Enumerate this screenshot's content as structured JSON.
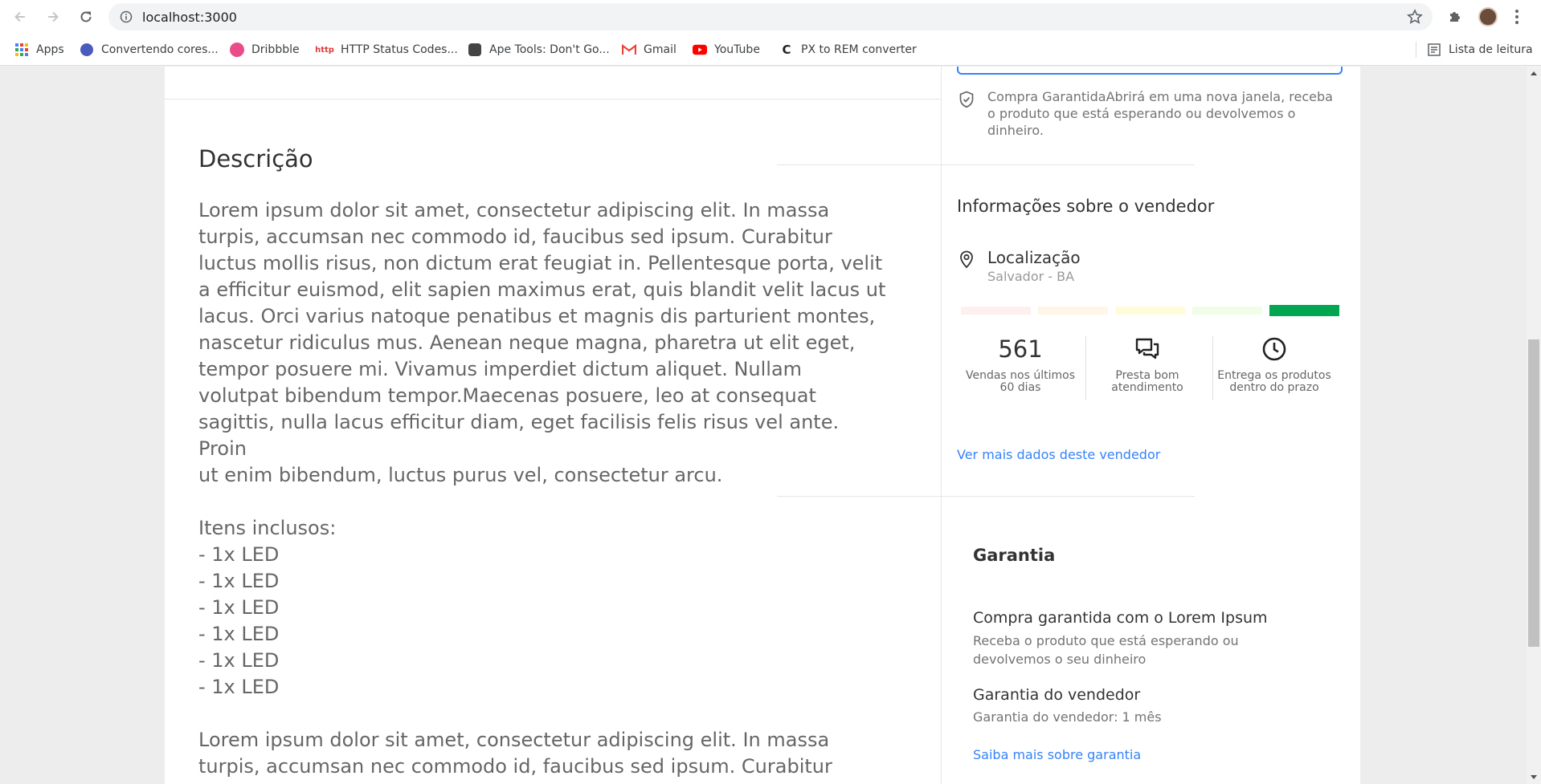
{
  "browser": {
    "url": "localhost:3000",
    "bookmarks": [
      {
        "label": "Apps",
        "icon": "apps-grid-icon"
      },
      {
        "label": "Convertendo cores...",
        "icon": "globe-icon"
      },
      {
        "label": "Dribbble",
        "icon": "dribbble-icon"
      },
      {
        "label": "HTTP Status Codes...",
        "icon": "http-icon"
      },
      {
        "label": "Ape Tools: Don't Go...",
        "icon": "ape-icon"
      },
      {
        "label": "Gmail",
        "icon": "gmail-icon"
      },
      {
        "label": "YouTube",
        "icon": "youtube-icon"
      },
      {
        "label": "PX to REM converter",
        "icon": "c-icon"
      }
    ],
    "reading_list": "Lista de leitura"
  },
  "description": {
    "title": "Descrição",
    "body": "Lorem ipsum dolor sit amet, consectetur adipiscing elit. In massa\nturpis, accumsan nec commodo id, faucibus sed ipsum. Curabitur\nluctus mollis risus, non dictum erat feugiat in. Pellentesque porta, velit\na efficitur euismod, elit sapien maximus erat, quis blandit velit lacus ut\nlacus. Orci varius natoque penatibus et magnis dis parturient montes,\nnascetur ridiculus mus. Aenean neque magna, pharetra ut elit eget,\ntempor posuere mi. Vivamus imperdiet dictum aliquet. Nullam\nvolutpat bibendum tempor.Maecenas posuere, leo at consequat\nsagittis, nulla lacus efficitur diam, eget facilisis felis risus vel ante. Proin\nut enim bibendum, luctus purus vel, consectetur arcu.\n\nItens inclusos:\n- 1x LED\n- 1x LED\n- 1x LED\n- 1x LED\n- 1x LED\n- 1x LED\n\nLorem ipsum dolor sit amet, consectetur adipiscing elit. In massa\nturpis, accumsan nec commodo id, faucibus sed ipsum. Curabitur\nluctus mollis risus, non dictum erat feugiat in. Pellentesque porta, velit"
  },
  "protected_purchase": {
    "text": "Compra GarantidaAbrirá em uma nova janela, receba o produto que está esperando ou devolvemos o dinheiro.",
    "icon": "shield-check-icon"
  },
  "seller": {
    "title": "Informações sobre o vendedor",
    "location_label": "Localização",
    "location_value": "Salvador - BA",
    "thermometer_colors": [
      "#fff0f0",
      "#fff5e8",
      "#fffcda",
      "#f1fde7",
      "#00a650"
    ],
    "thermometer_level": 5,
    "metrics": [
      {
        "value": "561",
        "label": "Vendas nos últimos 60 dias"
      },
      {
        "icon": "chat-bubbles-icon",
        "label": "Presta bom atendimento"
      },
      {
        "icon": "clock-icon",
        "label": "Entrega os produtos dentro do prazo"
      }
    ],
    "more_link": "Ver mais dados deste vendedor"
  },
  "warranty": {
    "title": "Garantia",
    "protected_heading": "Compra garantida com o Lorem Ipsum",
    "protected_text": "Receba o produto que está esperando ou devolvemos o seu dinheiro",
    "seller_heading": "Garantia do vendedor",
    "seller_text": "Garantia do vendedor: 1 mês",
    "more_link": "Saiba mais sobre garantia"
  },
  "colors": {
    "accent": "#3483fa",
    "positive": "#00a650"
  }
}
